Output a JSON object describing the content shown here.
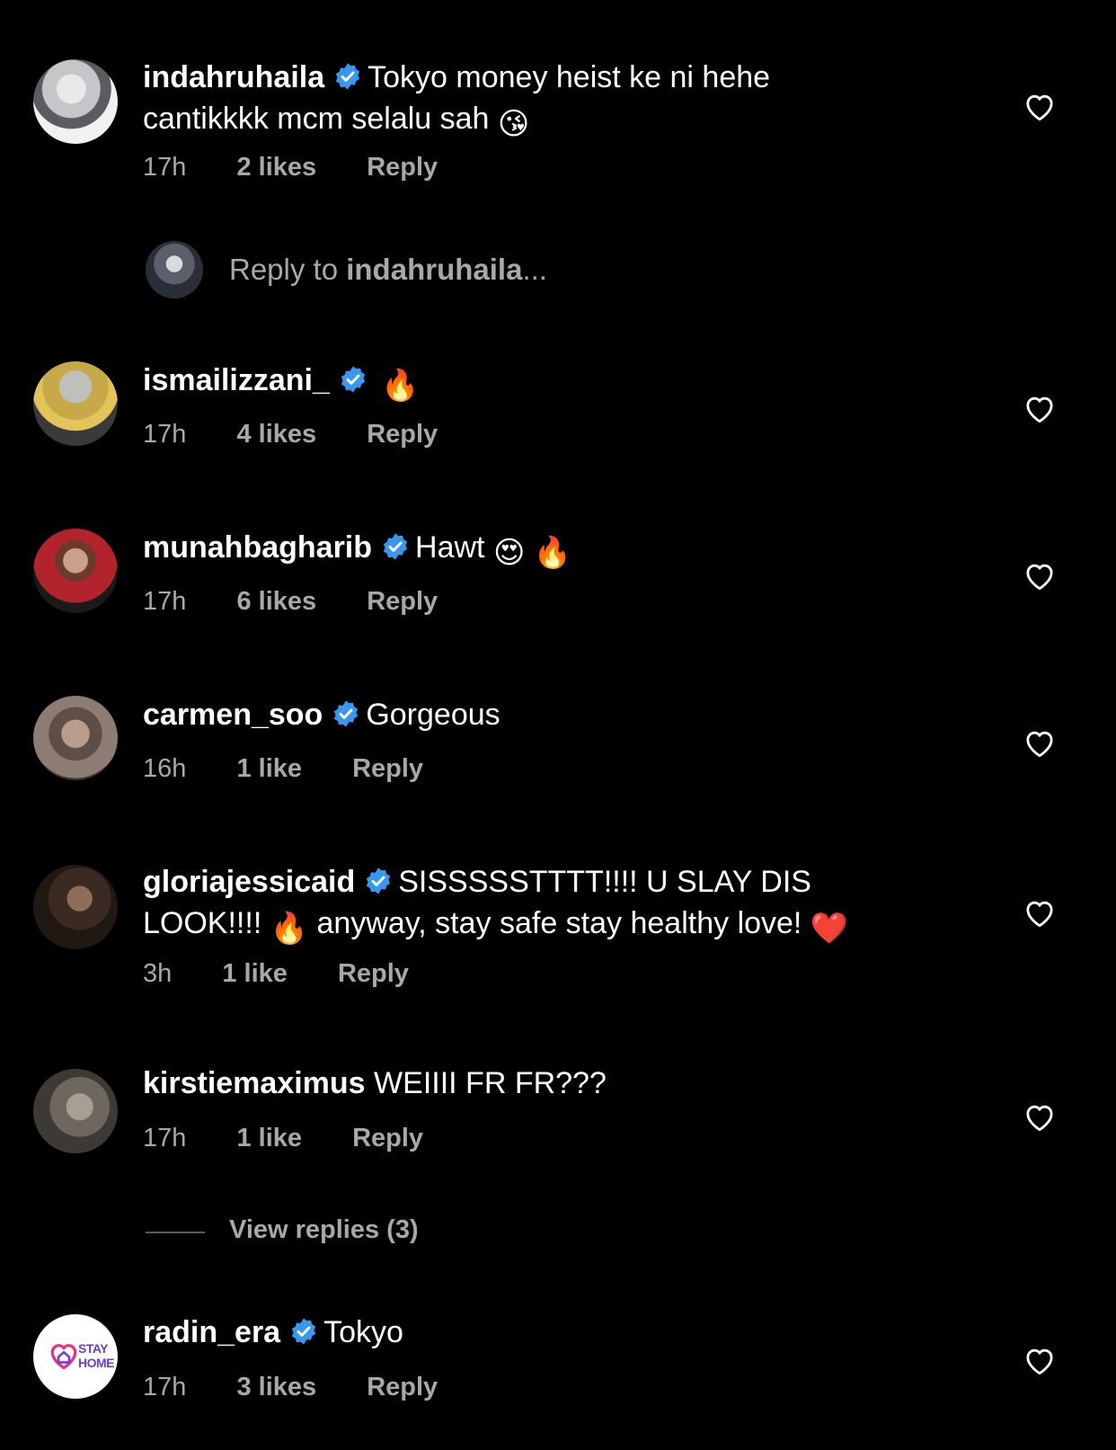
{
  "comments": [
    {
      "username": "indahruhaila",
      "verified": true,
      "text_line1": "Tokyo money heist ke ni hehe",
      "text_line2": "cantikkkk mcm selalu sah",
      "emoji": "😘",
      "time": "17h",
      "likes": "2 likes",
      "reply": "Reply"
    },
    {
      "username": "ismailizzani_",
      "verified": true,
      "text": "",
      "emoji": "🔥",
      "time": "17h",
      "likes": "4 likes",
      "reply": "Reply"
    },
    {
      "username": "munahbagharib",
      "verified": true,
      "text": "Hawt",
      "emoji": "😍 🔥",
      "time": "17h",
      "likes": "6 likes",
      "reply": "Reply"
    },
    {
      "username": "carmen_soo",
      "verified": true,
      "text": "Gorgeous",
      "time": "16h",
      "likes": "1 like",
      "reply": "Reply"
    },
    {
      "username": "gloriajessicaid",
      "verified": true,
      "text_line1": "SISSSSSTTTT!!!! U SLAY DIS",
      "text_line2_a": "LOOK!!!!",
      "emoji_a": "🔥",
      "text_line2_b": "anyway, stay safe stay healthy love!",
      "emoji_b": "❤️",
      "time": "3h",
      "likes": "1 like",
      "reply": "Reply"
    },
    {
      "username": "kirstiemaximus",
      "verified": false,
      "text": "WEIIII FR FR???",
      "time": "17h",
      "likes": "1 like",
      "reply": "Reply"
    },
    {
      "username": "radin_era",
      "verified": true,
      "text": "Tokyo",
      "avatar_text_1": "STAY",
      "avatar_text_2": "HOME",
      "time": "17h",
      "likes": "3 likes",
      "reply": "Reply"
    }
  ],
  "reply_to": {
    "prefix": "Reply to",
    "username": "indahruhaila",
    "suffix": "..."
  },
  "view_replies": "View replies (3)",
  "colors": {
    "background": "#000000",
    "text": "#ffffff",
    "muted": "#a8a8a8",
    "verified": "#3897f0"
  },
  "icons": [
    "verified-badge-icon",
    "heart-outline-icon"
  ]
}
